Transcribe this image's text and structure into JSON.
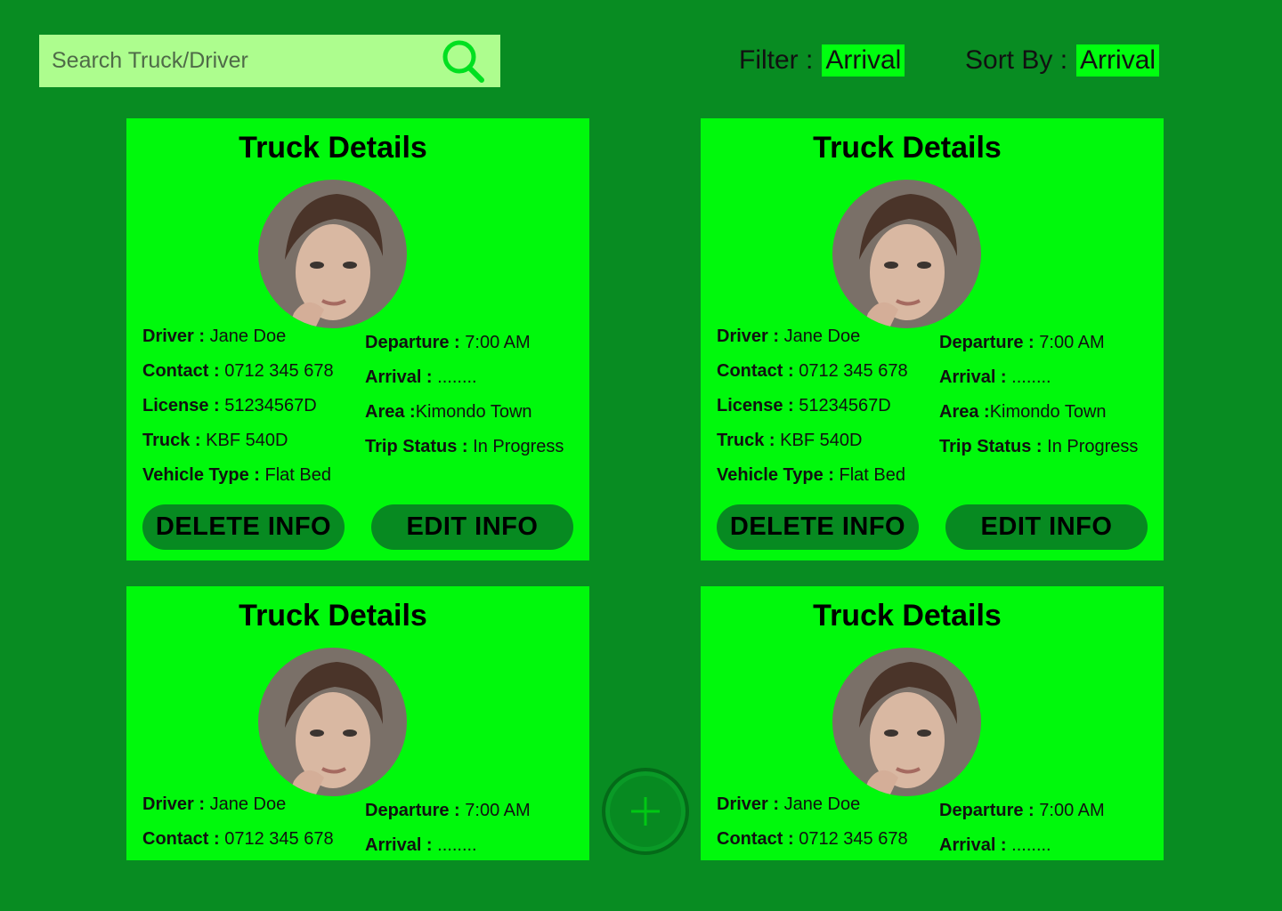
{
  "search": {
    "placeholder": "Search Truck/Driver",
    "icon": "search-icon"
  },
  "filter": {
    "label": "Filter :",
    "value": "Arrival"
  },
  "sort": {
    "label": "Sort By :",
    "value": "Arrival"
  },
  "cards": [
    {
      "title": "Truck Details",
      "driver_label": "Driver :",
      "driver": "Jane Doe",
      "contact_label": "Contact",
      "contact": "0712 345 678",
      "license_label": "License :",
      "license": "51234567D",
      "truck_label": "Truck :",
      "truck": "KBF 540D",
      "vehicle_type_label": "Vehicle Type",
      "vehicle_type": "Flat Bed",
      "departure_label": "Departure :",
      "departure": "7:00 AM",
      "arrival_label": "Arrival :",
      "arrival": "........",
      "area_label": "Area",
      "area": "Kimondo Town",
      "trip_status_label": "Trip Status",
      "trip_status": "In Progress",
      "delete_label": "DELETE INFO",
      "edit_label": "EDIT INFO"
    },
    {
      "title": "Truck Details",
      "driver_label": "Driver :",
      "driver": "Jane Doe",
      "contact_label": "Contact",
      "contact": "0712 345 678",
      "license_label": "License :",
      "license": "51234567D",
      "truck_label": "Truck :",
      "truck": "KBF 540D",
      "vehicle_type_label": "Vehicle Type",
      "vehicle_type": "Flat Bed",
      "departure_label": "Departure :",
      "departure": "7:00 AM",
      "arrival_label": "Arrival :",
      "arrival": "........",
      "area_label": "Area",
      "area": "Kimondo Town",
      "trip_status_label": "Trip Status",
      "trip_status": "In Progress",
      "delete_label": "DELETE INFO",
      "edit_label": "EDIT INFO"
    },
    {
      "title": "Truck Details",
      "driver_label": "Driver :",
      "driver": "Jane Doe",
      "contact_label": "Contact",
      "contact": "0712 345 678",
      "departure_label": "Departure :",
      "departure": "7:00 AM",
      "arrival_label": "Arrival :",
      "arrival": "........"
    },
    {
      "title": "Truck Details",
      "driver_label": "Driver :",
      "driver": "Jane Doe",
      "contact_label": "Contact",
      "contact": "0712 345 678",
      "departure_label": "Departure :",
      "departure": "7:00 AM",
      "arrival_label": "Arrival :",
      "arrival": "........"
    }
  ],
  "colors": {
    "background": "#088c22",
    "card": "#00f90c",
    "button": "#078a21",
    "search_bg": "#adfd8e",
    "highlight": "#00ff0f"
  },
  "fab": {
    "icon": "plus-icon"
  }
}
